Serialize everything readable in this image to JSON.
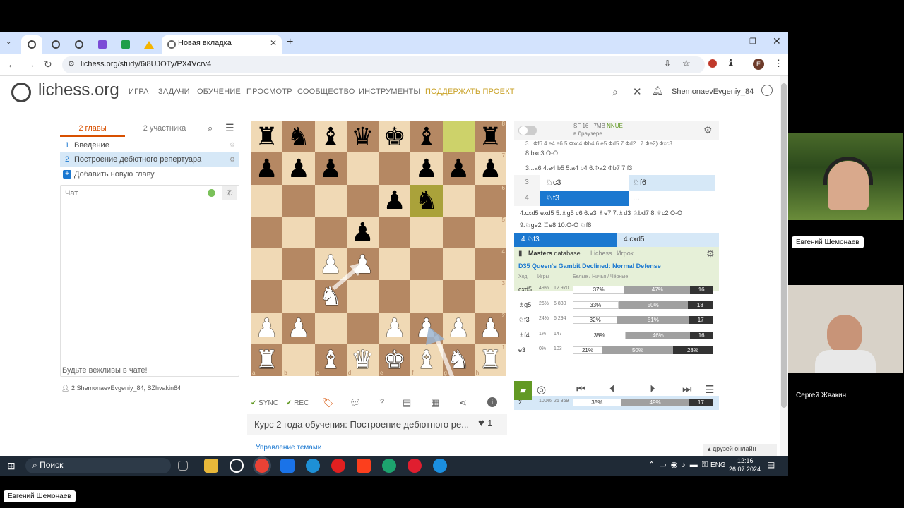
{
  "browser": {
    "tab_title": "Новая вкладка",
    "url": "lichess.org/study/6i8UJOTy/PX4Vcrv4",
    "profile_initial": "E"
  },
  "site": {
    "logo": "lichess.org",
    "nav": [
      "ИГРА",
      "ЗАДАЧИ",
      "ОБУЧЕНИЕ",
      "ПРОСМОТР",
      "СООБЩЕСТВО",
      "ИНСТРУМЕНТЫ"
    ],
    "donate": "ПОДДЕРЖАТЬ ПРОЕКТ",
    "username": "ShemonaevEvgeniy_84"
  },
  "study": {
    "tab_chapters": "2 главы",
    "tab_members": "2 участника",
    "chapters": [
      {
        "num": "1",
        "title": "Введение"
      },
      {
        "num": "2",
        "title": "Построение дебютного репертуара"
      }
    ],
    "add_chapter": "Добавить новую главу",
    "chat_label": "Чат",
    "chat_placeholder": "Будьте вежливы в чате!",
    "members_count": "2",
    "members": "ShemonaevEvgeniy_84, SZhvakin84",
    "toolbar": {
      "sync": "SYNC",
      "rec": "REC"
    },
    "title": "Курс 2 года обучения: Построение дебютного ре...",
    "likes": "1",
    "topics": "Управление темами"
  },
  "board": {
    "files": [
      "a",
      "b",
      "c",
      "d",
      "e",
      "f",
      "g",
      "h"
    ],
    "ranks": [
      "8",
      "7",
      "6",
      "5",
      "4",
      "3",
      "2",
      "1"
    ],
    "rows": [
      [
        "r",
        "n",
        "b",
        "q",
        "k",
        "b",
        "",
        "r"
      ],
      [
        "p",
        "p",
        "p",
        "",
        "",
        "p",
        "p",
        "p"
      ],
      [
        "",
        "",
        "",
        "",
        "p",
        "n",
        "",
        ""
      ],
      [
        "",
        "",
        "",
        "p",
        "",
        "",
        "",
        ""
      ],
      [
        "",
        "",
        "P",
        "P",
        "",
        "",
        "",
        ""
      ],
      [
        "",
        "",
        "N",
        "",
        "",
        "",
        "",
        ""
      ],
      [
        "P",
        "P",
        "",
        "",
        "P",
        "P",
        "P",
        "P"
      ],
      [
        "R",
        "",
        "B",
        "Q",
        "K",
        "B",
        "N",
        "R"
      ]
    ]
  },
  "engine": {
    "name": "SF 16 · 7MB",
    "nnue": "NNUE",
    "where": "в браузере",
    "lines": [
      "3...Фf6 4.e4 e6 5.Фxc4 Фb4 6.e5 Фd5 7.Фd2 | 7.Фe2) Фxc3",
      "8.bxc3 O-O",
      "3...a6 4.e4 b5 5.a4 b4 6.Фa2 Фb7 7.f3"
    ]
  },
  "moves": {
    "row3": {
      "num": "3",
      "white": "♘c3",
      "black": "♘f6"
    },
    "row4": {
      "num": "4",
      "white": "♘f3",
      "black": "..."
    },
    "variation1": "4.cxd5 exd5 5.♗g5 c6 6.e3 ♗e7 7.♗d3 ♘bd7 8.♕c2 O-O",
    "variation2": "9.♘ge2 ♖e8 10.O-O ♘f8",
    "next_main": "4.♘f3",
    "next_alt": "4.cxd5"
  },
  "explorer": {
    "db_label": "Masters",
    "db_word": "database",
    "tab_lichess": "Lichess",
    "tab_player": "Игрок",
    "opening": "D35 Queen's Gambit Declined: Normal Defense",
    "headers": {
      "move": "Ход",
      "games": "Игры",
      "results": "Белые / Ничья / Чёрные"
    },
    "rows": [
      {
        "move": "cxd5",
        "pct": "49%",
        "games": "12 970",
        "white": 37,
        "draw": 47,
        "black": 16,
        "wl": "37%",
        "dl": "47%",
        "bl": "16"
      },
      {
        "move": "♗g5",
        "pct": "26%",
        "games": "6 830",
        "white": 33,
        "draw": 50,
        "black": 18,
        "wl": "33%",
        "dl": "50%",
        "bl": "18"
      },
      {
        "move": "♘f3",
        "pct": "24%",
        "games": "6 294",
        "white": 32,
        "draw": 51,
        "black": 17,
        "wl": "32%",
        "dl": "51%",
        "bl": "17"
      },
      {
        "move": "♗f4",
        "pct": "1%",
        "games": "147",
        "white": 38,
        "draw": 46,
        "black": 16,
        "wl": "38%",
        "dl": "46%",
        "bl": "16"
      },
      {
        "move": "e3",
        "pct": "0%",
        "games": "103",
        "white": 21,
        "draw": 50,
        "black": 28,
        "wl": "21%",
        "dl": "50%",
        "bl": "28%"
      }
    ],
    "total": {
      "sym": "Σ",
      "pct": "100%",
      "games": "26 369",
      "white": 35,
      "draw": 49,
      "black": 17,
      "wl": "35%",
      "dl": "49%",
      "bl": "17"
    }
  },
  "footer": {
    "friends": "друзей онлайн"
  },
  "taskbar": {
    "search": "Поиск",
    "lang": "ENG",
    "time": "12:16",
    "date": "26.07.2024"
  },
  "call": {
    "speaker1": "Евгений Шемонаев",
    "speaker2": "Сергей Жвакин",
    "self_name": "Евгений Шемонаев"
  }
}
